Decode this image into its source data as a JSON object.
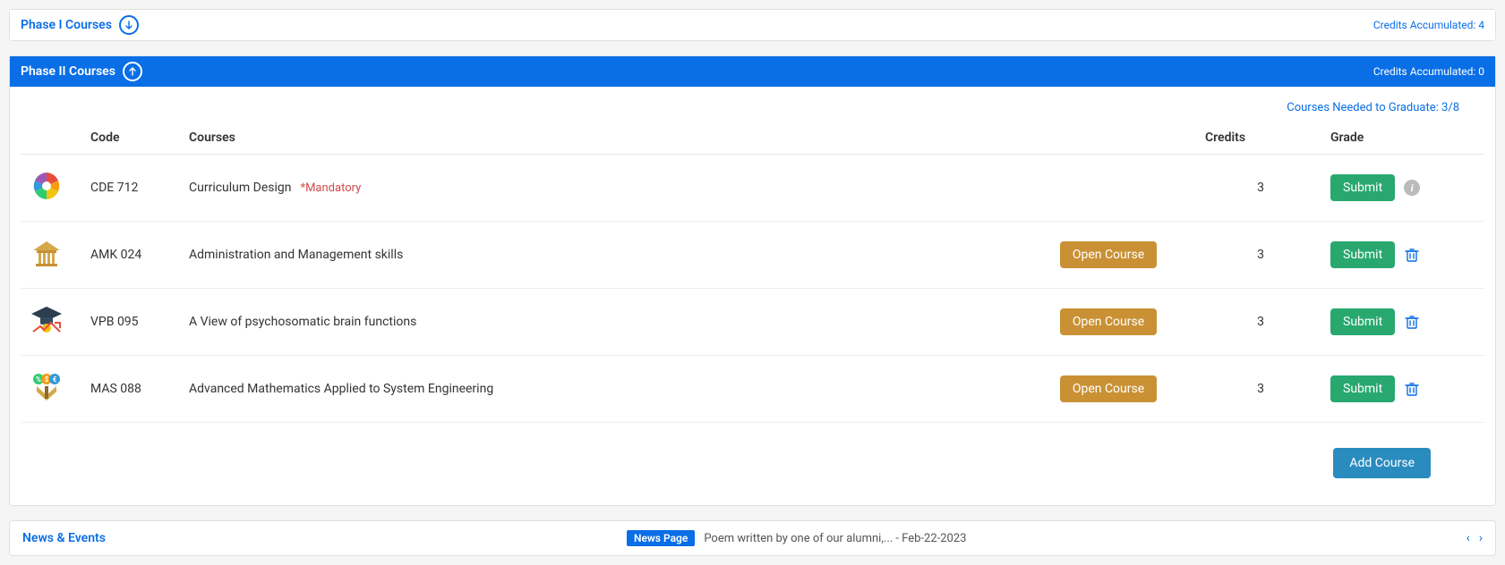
{
  "phase1": {
    "title": "Phase I Courses",
    "credits_label": "Credits Accumulated: 4"
  },
  "phase2": {
    "title": "Phase II Courses",
    "credits_label": "Credits Accumulated: 0",
    "needed_label": "Courses Needed to Graduate: 3/8",
    "headers": {
      "code": "Code",
      "courses": "Courses",
      "credits": "Credits",
      "grade": "Grade"
    },
    "open_course_label": "Open Course",
    "submit_label": "Submit",
    "add_course_label": "Add Course",
    "mandatory_tag": "*Mandatory",
    "rows": [
      {
        "code": "CDE 712",
        "name": "Curriculum Design",
        "credits": "3",
        "mandatory": true,
        "openable": false,
        "icon": "design-icon",
        "action_icon": "info"
      },
      {
        "code": "AMK 024",
        "name": "Administration and Management skills",
        "credits": "3",
        "mandatory": false,
        "openable": true,
        "icon": "building-icon",
        "action_icon": "trash"
      },
      {
        "code": "VPB 095",
        "name": "A View of psychosomatic brain functions",
        "credits": "3",
        "mandatory": false,
        "openable": true,
        "icon": "graduation-icon",
        "action_icon": "trash"
      },
      {
        "code": "MAS 088",
        "name": "Advanced Mathematics Applied to System Engineering",
        "credits": "3",
        "mandatory": false,
        "openable": true,
        "icon": "math-icon",
        "action_icon": "trash"
      }
    ]
  },
  "news": {
    "title": "News & Events",
    "tag": "News Page",
    "text": "Poem written by one of our alumni,... - Feb-22-2023"
  }
}
